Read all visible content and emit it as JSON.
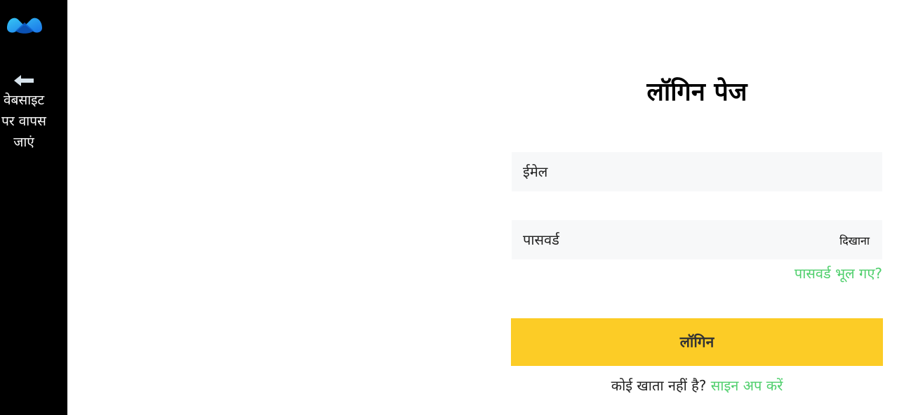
{
  "sidebar": {
    "logo_icon": "brand-logo-icon",
    "back_icon": "arrow-left-icon",
    "back_label": "वेबसाइट पर वापस जाएं"
  },
  "login": {
    "title": "लॉगिन पेज",
    "email_placeholder": "ईमेल",
    "password_placeholder": "पासवर्ड",
    "show_password_label": "दिखाना",
    "forgot_password_label": "पासवर्ड भूल गए?",
    "login_button_label": "लॉगिन",
    "no_account_text": "कोई खाता नहीं है?",
    "signup_link_label": "साइन अप करें"
  },
  "colors": {
    "sidebar_bg": "#000000",
    "accent_green": "#4fcf6c",
    "button_yellow": "#fccc26",
    "field_bg": "#f7f8f9",
    "logo_blue": "#1e9bf0"
  }
}
